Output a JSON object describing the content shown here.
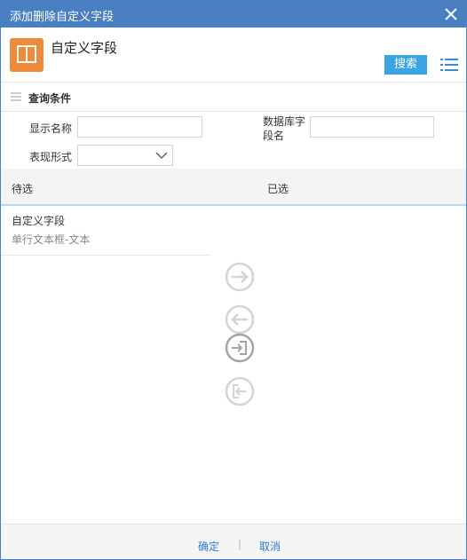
{
  "window": {
    "title": "添加删除自定义字段",
    "close_icon": "close-icon"
  },
  "header": {
    "title": "自定义字段",
    "logo_icon": "book-icon",
    "search_label": "搜索",
    "menu_icon": "list-icon"
  },
  "conditions": {
    "label": "查询条件",
    "fields": {
      "display_name": {
        "label": "显示名称",
        "value": ""
      },
      "db_field_name": {
        "label_line1": "数据库字",
        "label_line2": "段名",
        "value": ""
      },
      "presentation": {
        "label": "表现形式",
        "value": ""
      }
    }
  },
  "tabs": {
    "pending": "待选",
    "selected": "已选"
  },
  "available_items": [
    {
      "name": "自定义字段",
      "type": "单行文本框-文本"
    }
  ],
  "transfer_icons": [
    "arrow-right-circle-icon",
    "arrow-left-circle-icon",
    "move-all-in-icon",
    "move-all-out-icon"
  ],
  "footer": {
    "confirm": "确定",
    "separator": "|",
    "cancel": "取消"
  },
  "colors": {
    "titlebar": "#4a7fc1",
    "accent": "#3aa3e3",
    "logo": "#ef8a3a",
    "link": "#2b7bd0"
  }
}
